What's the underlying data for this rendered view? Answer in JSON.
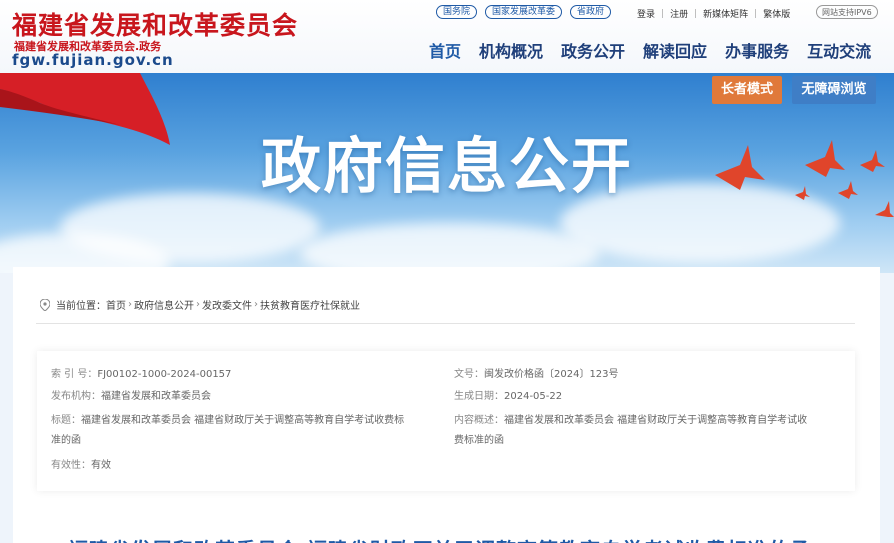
{
  "header": {
    "logo_cn": "福建省发展和改革委员会",
    "logo_sub": "福建省发展和改革委员会.政务",
    "logo_domain": "fgw.fujian.gov.cn",
    "quick_links": [
      "国务院",
      "国家发展改革委",
      "省政府"
    ],
    "top_links": [
      "登录",
      "注册",
      "新媒体矩阵",
      "繁体版"
    ],
    "ipv6": "网站支持IPV6",
    "nav": [
      "首页",
      "机构概况",
      "政务公开",
      "解读回应",
      "办事服务",
      "互动交流"
    ]
  },
  "banner": {
    "title": "政府信息公开",
    "elder_mode": "长者模式",
    "accessible": "无障碍浏览"
  },
  "breadcrumb": {
    "prefix": "当前位置：",
    "items": [
      "首页",
      "政府信息公开",
      "发改委文件",
      "扶贫教育医疗社保就业"
    ]
  },
  "meta": {
    "index_label": "索 引 号：",
    "index_value": "FJ00102-1000-2024-00157",
    "docno_label": "文号：",
    "docno_value": "闽发改价格函〔2024〕123号",
    "publisher_label": "发布机构：",
    "publisher_value": "福建省发展和改革委员会",
    "date_label": "生成日期：",
    "date_value": "2024-05-22",
    "title_label": "标题：",
    "title_value_l1": "福建省发展和改革委员会 福建省财政厅关于调整高等教育自学考试收费标",
    "title_value_l2": "准的函",
    "summary_label": "内容概述：",
    "summary_value_l1": "福建省发展和改革委员会 福建省财政厅关于调整高等教育自学考试收",
    "summary_value_l2": "费标准的函",
    "validity_label": "有效性：",
    "validity_value": "有效"
  },
  "doc_title": "福建省发展和改革委员会 福建省财政厅关于调整高等教育自学考试收费标准的函",
  "colors": {
    "brand_red": "#c8161d",
    "brand_blue": "#1f5aa6",
    "elder_btn": "#e0793a",
    "access_btn": "#3f7ec6"
  }
}
